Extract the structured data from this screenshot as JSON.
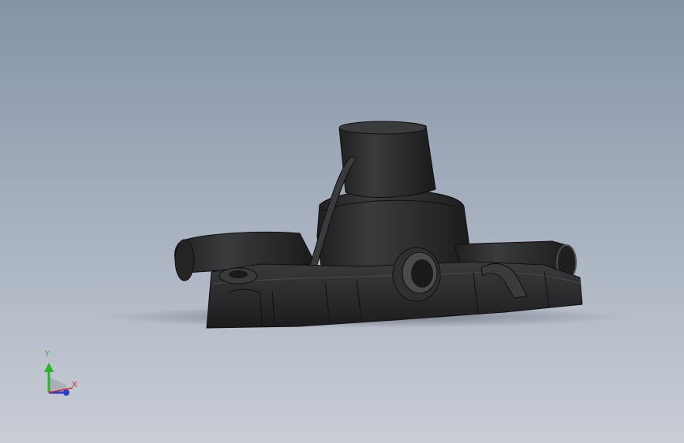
{
  "viewport": {
    "background_top": "#8593a8",
    "background_bottom": "#c9ced6",
    "model_color": "#2b2b2c",
    "model_edge_color": "#0f0f10",
    "model_highlight": "#4a4b4d"
  },
  "triad": {
    "y_label": "Y",
    "x_label": "X",
    "y_color": "#2bb32b",
    "x_color": "#d22a2a",
    "z_color": "#2a3fd2"
  }
}
